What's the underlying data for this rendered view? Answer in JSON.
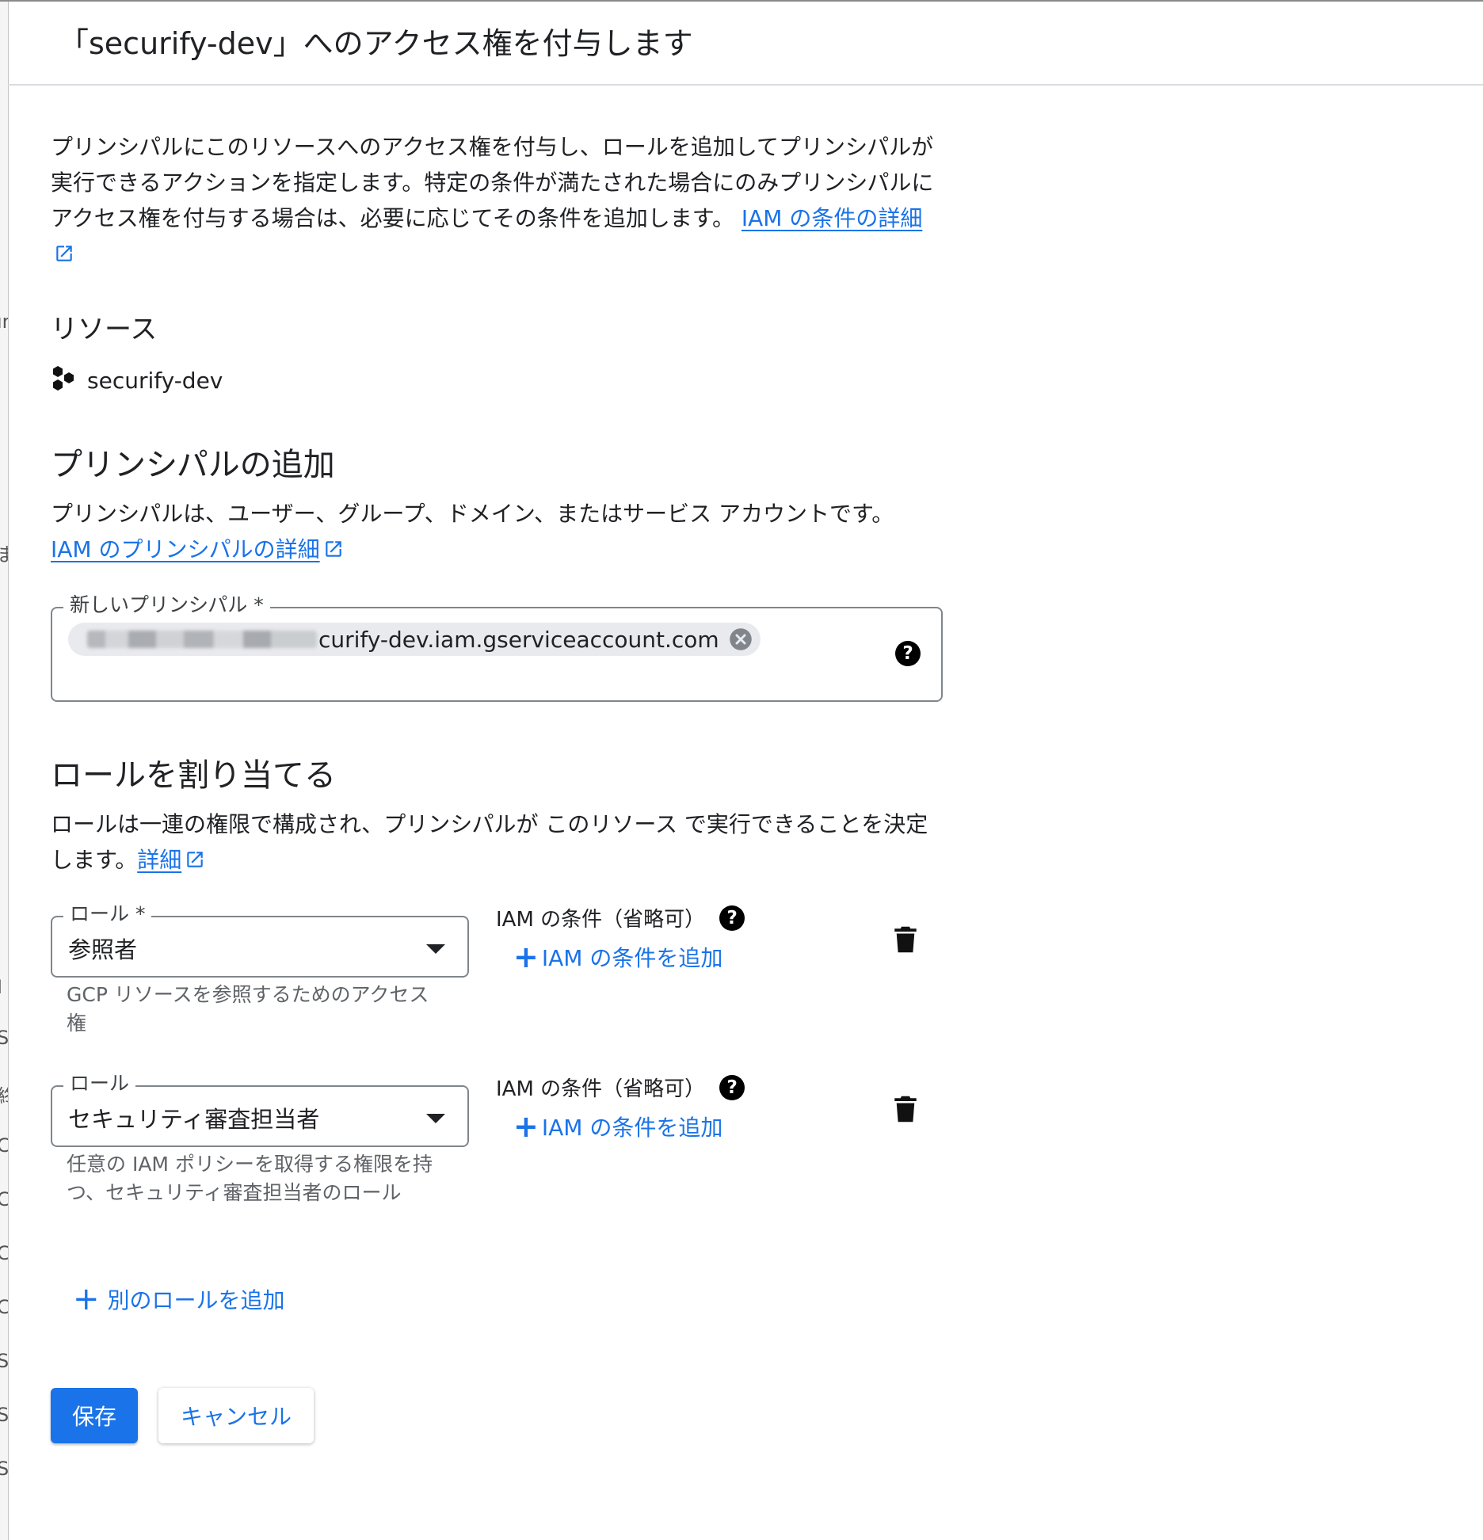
{
  "dialog": {
    "title": "「securify-dev」へのアクセス権を付与します",
    "intro_text": "プリンシパルにこのリソースへのアクセス権を付与し、ロールを追加してプリンシパルが実行できるアクションを指定します。特定の条件が満たされた場合にのみプリンシパルにアクセス権を付与する場合は、必要に応じてその条件を追加します。",
    "intro_link": "IAM の条件の詳細"
  },
  "resource": {
    "heading": "リソース",
    "name": "securify-dev",
    "icon": "project-hexagon-icon"
  },
  "principals": {
    "heading": "プリンシパルの追加",
    "description": "プリンシパルは、ユーザー、グループ、ドメイン、またはサービス アカウントです。",
    "link": "IAM のプリンシパルの詳細",
    "field_label": "新しいプリンシパル *",
    "chip_text_visible": "curify-dev.iam.gserviceaccount.com"
  },
  "roles": {
    "heading": "ロールを割り当てる",
    "description": "ロールは一連の権限で構成され、プリンシパルが このリソース で実行できることを決定します。",
    "link": "詳細",
    "items": [
      {
        "label": "ロール *",
        "value": "参照者",
        "helper": "GCP リソースを参照するためのアクセス権",
        "condition_label": "IAM の条件（省略可）",
        "condition_add": "IAM の条件を追加"
      },
      {
        "label": "ロール",
        "value": "セキュリティ審査担当者",
        "helper": "任意の IAM ポリシーを取得する権限を持つ、セキュリティ審査担当者のロール",
        "condition_label": "IAM の条件（省略可）",
        "condition_add": "IAM の条件を追加"
      }
    ],
    "add_role": "別のロールを追加"
  },
  "actions": {
    "save": "保存",
    "cancel": "キャンセル"
  },
  "background_fragments": [
    "ır",
    "ま",
    "I",
    "S",
    "終",
    "C",
    "C",
    "C",
    "C",
    "S",
    "S",
    "S"
  ],
  "colors": {
    "accent": "#1a73e8",
    "text": "#202124",
    "border": "#80868b"
  }
}
